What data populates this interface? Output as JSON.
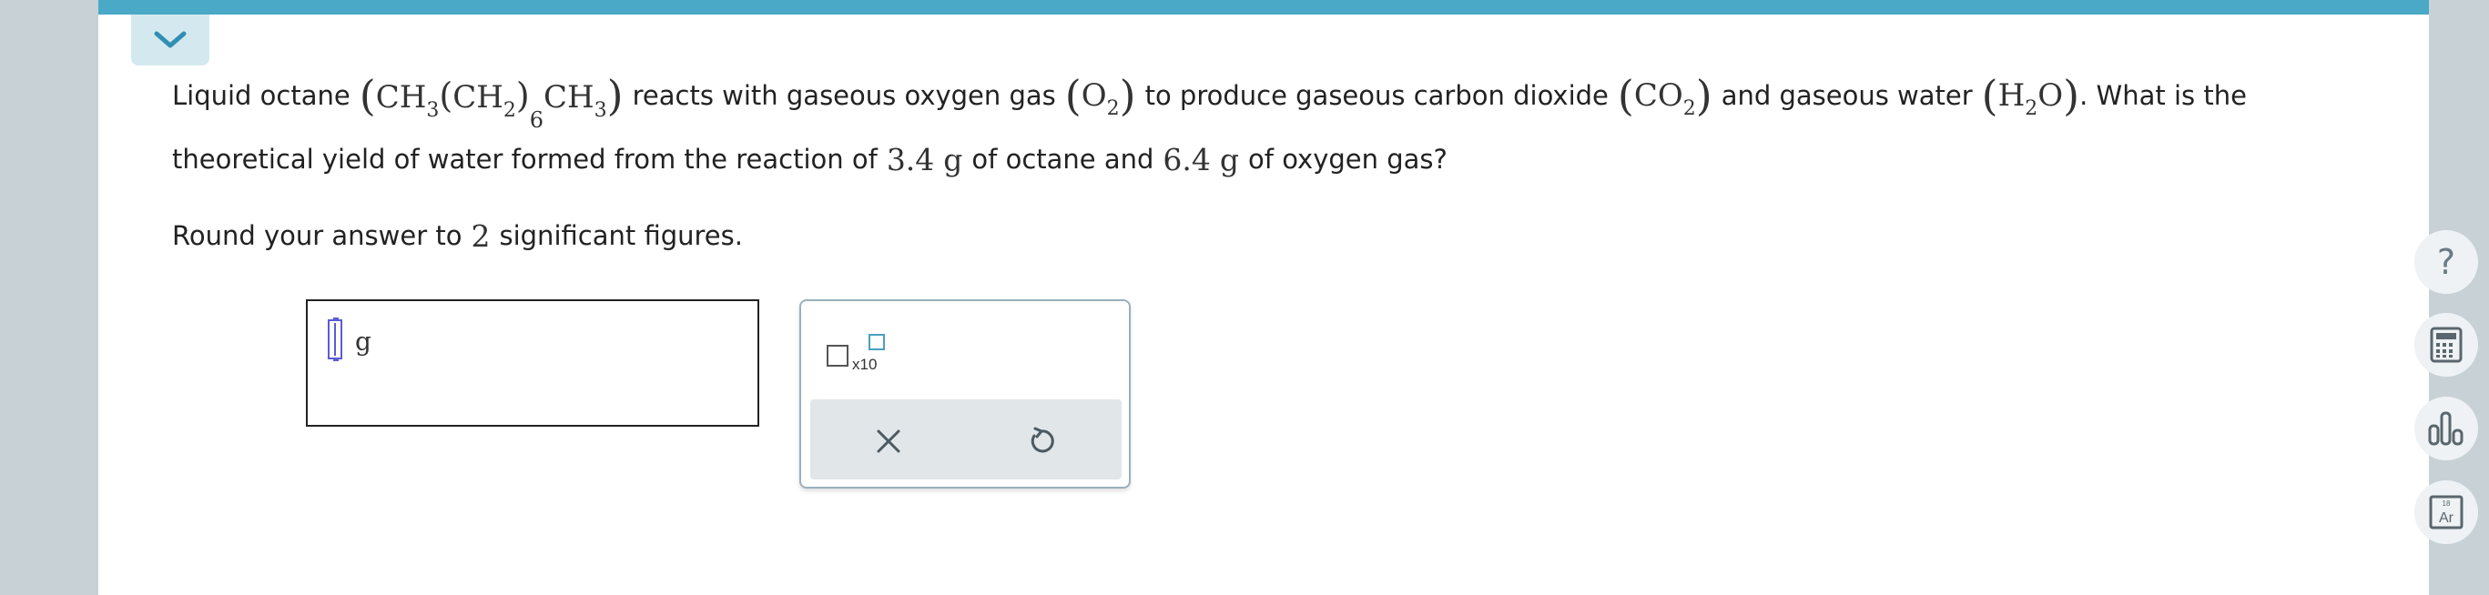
{
  "question": {
    "p1_a": "Liquid octane",
    "octane_ch3a": "CH",
    "octane_3a": "3",
    "octane_ch2": "CH",
    "octane_2": "2",
    "octane_6": "6",
    "octane_ch3b": "CH",
    "octane_3b": "3",
    "p1_b": "reacts with gaseous oxygen gas",
    "o2_o": "O",
    "o2_2": "2",
    "p1_c": "to produce gaseous carbon dioxide",
    "co2_co": "CO",
    "co2_2": "2",
    "p1_d": "and gaseous water",
    "h2o_h": "H",
    "h2o_2": "2",
    "h2o_o": "O",
    "p1_e": ". What is the",
    "p2_a": "theoretical yield of water formed from the reaction of",
    "octane_mass": "3.4",
    "unit_g1": "g",
    "p2_b": "of octane and",
    "oxygen_mass": "6.4",
    "unit_g2": "g",
    "p2_c": "of oxygen gas?",
    "p3_a": "Round your answer to",
    "sig_figs": "2",
    "p3_b": "significant figures."
  },
  "answer": {
    "value": "",
    "unit": "g"
  },
  "tools": {
    "sci_notation_label": "x10"
  },
  "side_tools": {
    "help": "?",
    "periodic_number": "18",
    "periodic_symbol": "Ar"
  },
  "colors": {
    "accent_bar": "#4aa9c6",
    "page_background": "#c7d1d6",
    "cursor": "#5b5cd6"
  }
}
